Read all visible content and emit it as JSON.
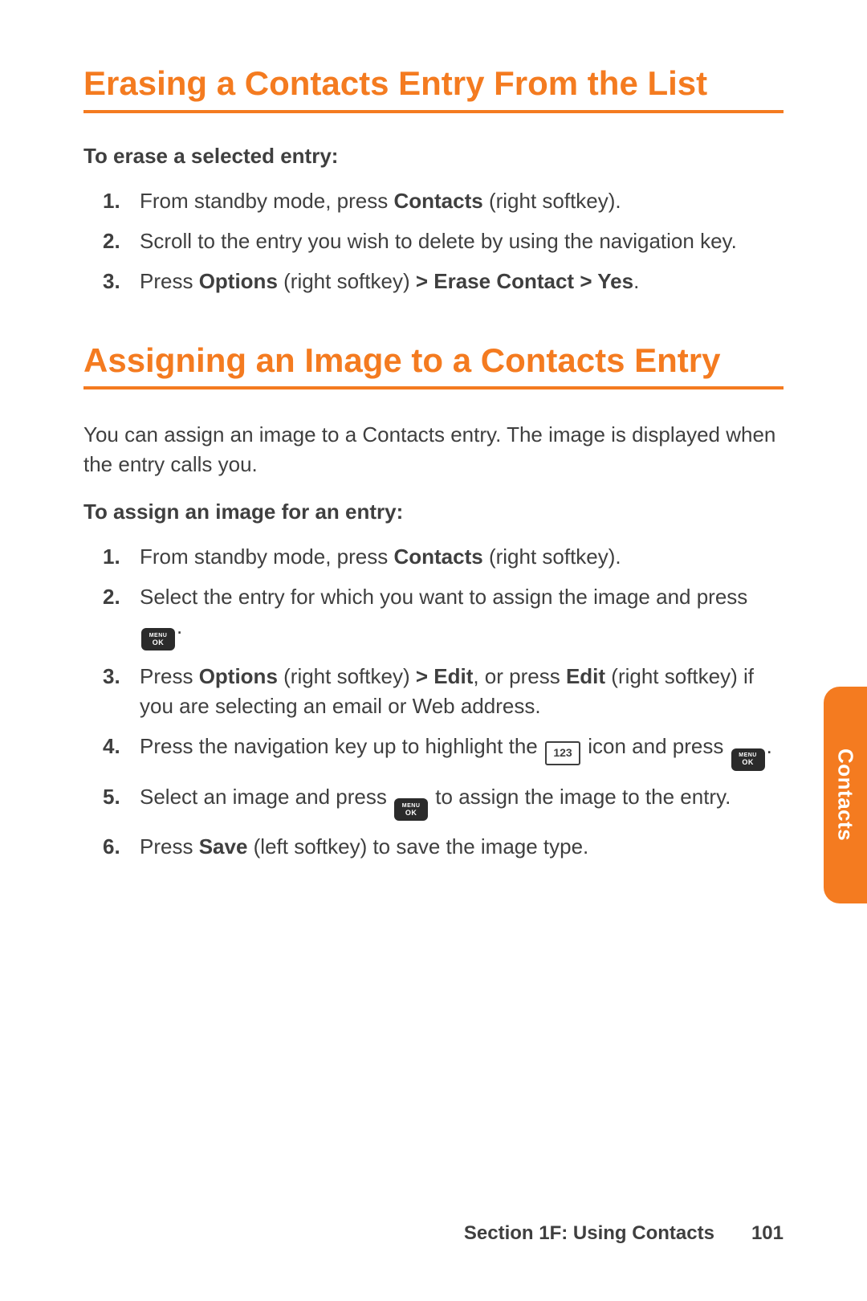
{
  "section1": {
    "heading": "Erasing a Contacts Entry From the List",
    "subhead": "To erase a selected entry:",
    "steps": [
      {
        "num": "1.",
        "pre": "From standby mode, press ",
        "bold1": "Contacts",
        "post": " (right softkey)."
      },
      {
        "num": "2.",
        "text": "Scroll to the entry you wish to delete by using the navigation key."
      },
      {
        "num": "3.",
        "pre": "Press ",
        "bold1": "Options",
        "mid": " (right softkey) ",
        "bold2": "> Erase Contact > Yes",
        "post": "."
      }
    ]
  },
  "section2": {
    "heading": "Assigning an Image to a Contacts Entry",
    "intro": "You can assign an image to a Contacts entry. The image is displayed when the entry calls you.",
    "subhead": "To assign an image for an entry:",
    "steps": [
      {
        "num": "1.",
        "pre": "From standby mode, press ",
        "bold1": "Contacts",
        "post": " (right softkey)."
      },
      {
        "num": "2.",
        "pre": "Select the entry for which you want to assign the image and press ",
        "icon": "menu-ok",
        "post": "."
      },
      {
        "num": "3.",
        "pre": "Press ",
        "bold1": "Options",
        "mid1": " (right softkey) ",
        "bold2": "> Edit",
        "mid2": ", or press ",
        "bold3": "Edit",
        "post": " (right softkey) if you are selecting an email or Web address."
      },
      {
        "num": "4.",
        "pre": "Press the navigation key up to highlight the ",
        "icon1": "num123",
        "mid": " icon and press ",
        "icon2": "menu-ok",
        "post": "."
      },
      {
        "num": "5.",
        "pre": "Select an image and press ",
        "icon": "menu-ok",
        "post": " to assign the image to the entry."
      },
      {
        "num": "6.",
        "pre": "Press ",
        "bold1": "Save",
        "post": " (left softkey) to save the image type."
      }
    ]
  },
  "sidetab": "Contacts",
  "footer": {
    "section": "Section 1F: Using Contacts",
    "page": "101"
  },
  "icons": {
    "menu_top": "MENU",
    "menu_bottom": "OK",
    "num123": "123"
  }
}
